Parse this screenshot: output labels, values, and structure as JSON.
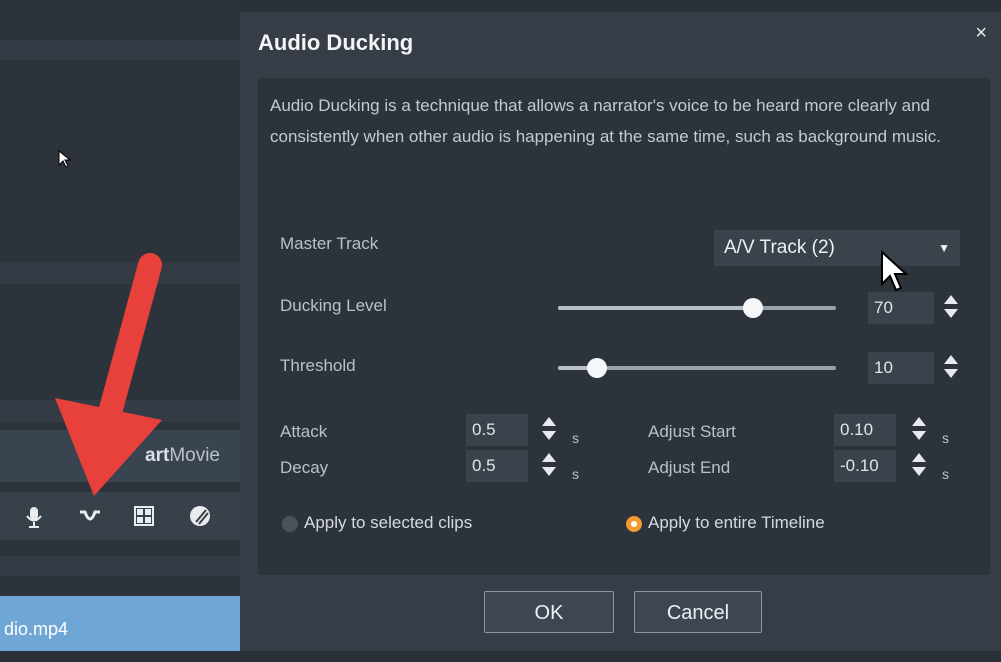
{
  "background": {
    "smartmovie_prefix": "art",
    "smartmovie_suffix": "Movie",
    "toolbar_icons": [
      "microphone-icon",
      "audio-ducking-icon",
      "grid-icon",
      "color-icon"
    ],
    "clip_label": "dio.mp4"
  },
  "dialog": {
    "title": "Audio Ducking",
    "close_label": "×",
    "description": "Audio Ducking is a technique that allows a narrator's voice to be heard more clearly and consistently when other audio is happening at the same time, such as background music.",
    "master_track_label": "Master Track",
    "master_track_value": "A/V Track (2)",
    "ducking_level_label": "Ducking Level",
    "ducking_level_value": "70",
    "ducking_level_fraction": 0.7,
    "threshold_label": "Threshold",
    "threshold_value": "10",
    "threshold_fraction": 0.14,
    "attack_label": "Attack",
    "attack_value": "0.5",
    "decay_label": "Decay",
    "decay_value": "0.5",
    "adjust_start_label": "Adjust Start",
    "adjust_start_value": "0.10",
    "adjust_end_label": "Adjust End",
    "adjust_end_value": "-0.10",
    "unit": "s",
    "apply_selected_label": "Apply to selected clips",
    "apply_timeline_label": "Apply to entire Timeline",
    "selected_option": "Apply to entire Timeline",
    "ok_label": "OK",
    "cancel_label": "Cancel"
  },
  "colors": {
    "accent_radio": "#f29a2e",
    "annotation_arrow": "#e8403a",
    "clip": "#6fa6d6"
  }
}
